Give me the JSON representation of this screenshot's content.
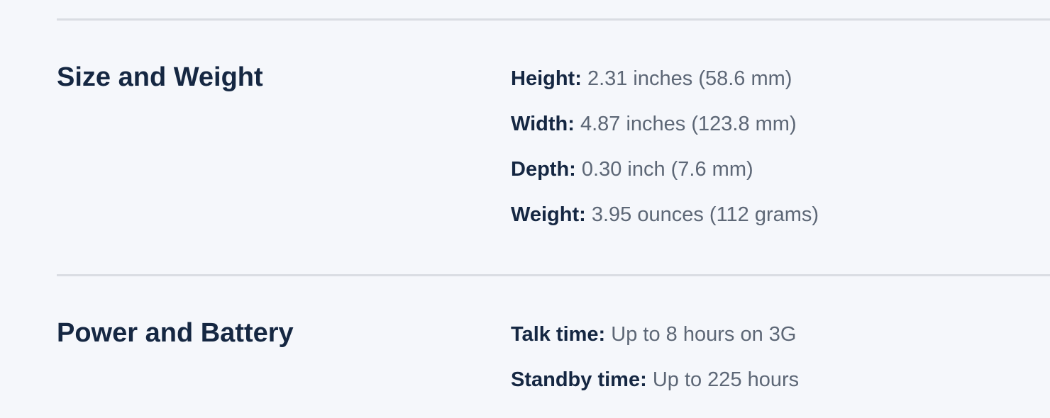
{
  "sections": [
    {
      "title": "Size and Weight",
      "specs": [
        {
          "label": "Height:",
          "value": "2.31 inches (58.6 mm)"
        },
        {
          "label": "Width:",
          "value": "4.87 inches (123.8 mm)"
        },
        {
          "label": "Depth:",
          "value": "0.30 inch (7.6 mm)"
        },
        {
          "label": "Weight:",
          "value": "3.95 ounces (112 grams)"
        }
      ]
    },
    {
      "title": "Power and Battery",
      "specs": [
        {
          "label": "Talk time:",
          "value": "Up to 8 hours on 3G"
        },
        {
          "label": "Standby time:",
          "value": "Up to 225 hours"
        }
      ]
    }
  ],
  "colors": {
    "background": "#f5f7fb",
    "heading": "#152742",
    "value_text": "#5d6776",
    "divider": "#dadde3"
  }
}
